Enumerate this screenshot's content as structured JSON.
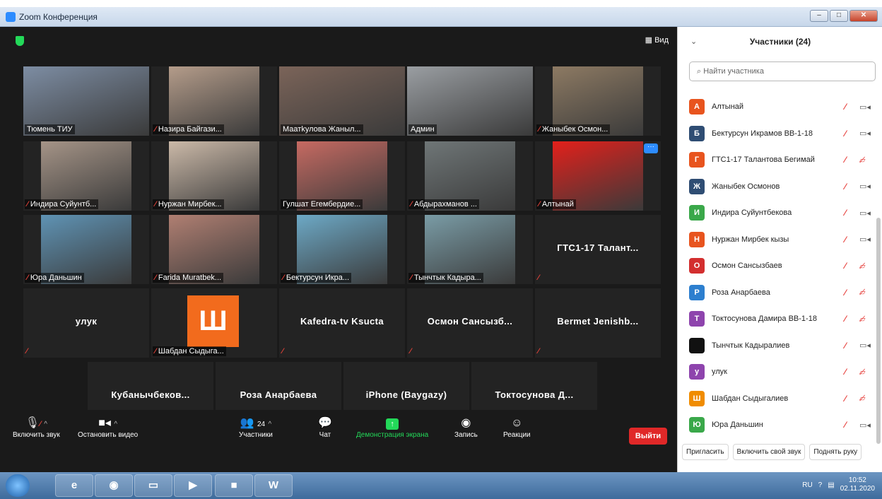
{
  "window": {
    "title": "Zoom Конференция"
  },
  "meeting": {
    "view_label": "Вид",
    "tiles": [
      {
        "name": "Тюмень ТИУ",
        "muted": false,
        "video": true,
        "color": "#7d8da3"
      },
      {
        "name": "Назира Байгази...",
        "muted": true,
        "video": true,
        "color": "#b49c8a"
      },
      {
        "name": "Маатkулова Жаныл...",
        "muted": false,
        "video": true,
        "color": "#7b6459"
      },
      {
        "name": "Админ",
        "muted": false,
        "video": true,
        "color": "#9a9ea2"
      },
      {
        "name": "Жаныбек Осмон...",
        "muted": true,
        "video": true,
        "color": "#8d7a63"
      },
      {
        "name": "Индира Суйунтб...",
        "muted": true,
        "video": true,
        "color": "#a59487"
      },
      {
        "name": "Нуржан Мирбек...",
        "muted": true,
        "video": true,
        "color": "#cbb9a8"
      },
      {
        "name": "Гулшат Егембердие...",
        "muted": false,
        "video": true,
        "color": "#c66a62"
      },
      {
        "name": "Абдырахманов ...",
        "muted": true,
        "video": true,
        "color": "#6f7677"
      },
      {
        "name": "Алтынай",
        "muted": true,
        "video": true,
        "color": "#e3201b"
      },
      {
        "name": "Юра Даньшин",
        "muted": true,
        "video": true,
        "color": "#5f93b4"
      },
      {
        "name": "Farida Muratbek...",
        "muted": true,
        "video": true,
        "color": "#b07f72"
      },
      {
        "name": "Бектурсун Икра...",
        "muted": true,
        "video": true,
        "color": "#6da9c6"
      },
      {
        "name": "Тынчтык Кадыра...",
        "muted": true,
        "video": true,
        "color": "#7a9ca6"
      },
      {
        "name": "ГТС1-17 Талант...",
        "muted": true,
        "video": false
      },
      {
        "name": "улук",
        "muted": true,
        "video": false
      },
      {
        "name": "Шабдан Сыдыга...",
        "muted": true,
        "video": false
      },
      {
        "name": "Kafedra-tv Ksucta",
        "muted": true,
        "video": false
      },
      {
        "name": "Осмон Сансызб...",
        "muted": true,
        "video": false
      },
      {
        "name": "Bermet Jenishb...",
        "muted": true,
        "video": false
      },
      {
        "name": "Кубанычбеков...",
        "muted": false,
        "video": false
      },
      {
        "name": "Роза Анарбаева",
        "muted": true,
        "video": false
      },
      {
        "name": "iPhone (Baygazy)",
        "muted": true,
        "video": false
      },
      {
        "name": "Токтосунова Д...",
        "muted": true,
        "video": false
      }
    ],
    "shabdan_letter": "Ш",
    "controls": {
      "audio": "Включить звук",
      "video": "Остановить видео",
      "participants": "Участники",
      "participants_count": "24",
      "chat": "Чат",
      "share": "Демонстрация экрана",
      "record": "Запись",
      "reactions": "Реакции",
      "leave": "Выйти"
    }
  },
  "panel": {
    "title": "Участники (24)",
    "search_placeholder": "Найти участника",
    "participants": [
      {
        "initial": "А",
        "name": "Алтынай",
        "color": "#e8541e",
        "video_off": false
      },
      {
        "initial": "Б",
        "name": "Бектурсун Икрамов ВВ-1-18",
        "color": "#2f4d73",
        "video_off": false
      },
      {
        "initial": "Г",
        "name": "ГТС1-17 Талантова Бегимай",
        "color": "#e8541e",
        "video_off": true
      },
      {
        "initial": "Ж",
        "name": "Жаныбек Осмонов",
        "color": "#2f4d73",
        "video_off": false
      },
      {
        "initial": "И",
        "name": "Индира Суйунтбекова",
        "color": "#3aa84a",
        "video_off": false
      },
      {
        "initial": "Н",
        "name": "Нуржан Мирбек кызы",
        "color": "#e8541e",
        "video_off": false
      },
      {
        "initial": "О",
        "name": "Осмон Сансызбаев",
        "color": "#d32f2f",
        "video_off": true
      },
      {
        "initial": "Р",
        "name": "Роза Анарбаева",
        "color": "#2d7fcf",
        "video_off": true
      },
      {
        "initial": "Т",
        "name": "Токтосунова Дамира ВВ-1-18",
        "color": "#8e44ad",
        "video_off": true
      },
      {
        "initial": "",
        "name": "Тынчтык Кадыралиев",
        "color": "#111111",
        "video_off": false
      },
      {
        "initial": "у",
        "name": "улук",
        "color": "#8e44ad",
        "video_off": true
      },
      {
        "initial": "Ш",
        "name": "Шабдан Сыдыгалиев",
        "color": "#f08c00",
        "video_off": true
      },
      {
        "initial": "Ю",
        "name": "Юра Даньшин",
        "color": "#3aa84a",
        "video_off": false
      }
    ],
    "invite": "Пригласить",
    "unmute_me": "Включить свой звук",
    "raise_hand": "Поднять руку"
  },
  "taskbar": {
    "lang": "RU",
    "time": "10:52",
    "date": "02.11.2020"
  }
}
